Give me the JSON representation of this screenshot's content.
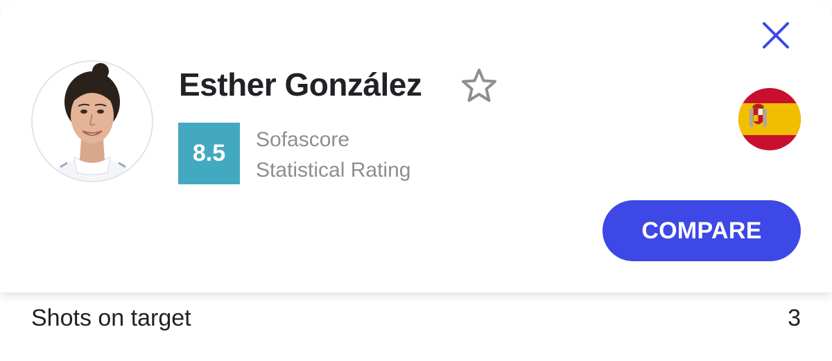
{
  "player": {
    "name": "Esther González",
    "avatar": "player-photo",
    "flag": "spain-flag",
    "favorite_icon": "star-outline-icon"
  },
  "rating": {
    "value": "8.5",
    "label_line1": "Sofascore",
    "label_line2": "Statistical Rating",
    "badge_color": "#43a9c0"
  },
  "actions": {
    "close_icon": "close-icon",
    "compare_label": "COMPARE"
  },
  "stat": {
    "label": "Shots on target",
    "value": "3"
  },
  "colors": {
    "accent": "#3d48e6",
    "text": "#222226",
    "muted": "#8e8e93",
    "flag_red": "#c8102e",
    "flag_yellow": "#f1bf00"
  }
}
